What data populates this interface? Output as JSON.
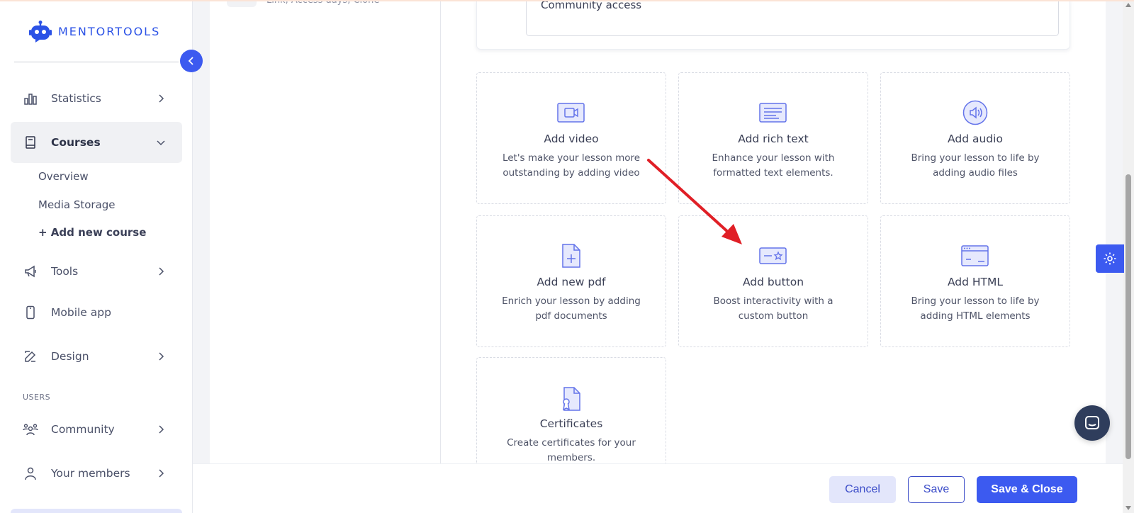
{
  "brand": {
    "name": "MENTORTOOLS",
    "accent": "#3c5af0"
  },
  "sidebar": {
    "items": [
      {
        "label": "Statistics",
        "icon": "bar-chart-icon"
      },
      {
        "label": "Courses",
        "icon": "book-icon",
        "active": true
      },
      {
        "label": "Tools",
        "icon": "megaphone-icon"
      },
      {
        "label": "Mobile app",
        "icon": "phone-icon"
      },
      {
        "label": "Design",
        "icon": "pencil-icon"
      },
      {
        "label": "Community",
        "icon": "people-icon"
      },
      {
        "label": "Your members",
        "icon": "user-icon"
      }
    ],
    "sub_items": [
      "Overview",
      "Media Storage",
      "+ Add new course"
    ],
    "section_users": "USERS"
  },
  "lesson_list": {
    "ghost_text": "Link, Access days, Clone"
  },
  "access": {
    "value": "Community access"
  },
  "tiles": [
    {
      "title": "Add video",
      "desc": "Let's make your lesson more outstanding by adding video",
      "icon": "video-icon"
    },
    {
      "title": "Add rich text",
      "desc": "Enhance your lesson with formatted text elements.",
      "icon": "rich-text-icon"
    },
    {
      "title": "Add audio",
      "desc": "Bring your lesson to life by adding audio files",
      "icon": "audio-icon"
    },
    {
      "title": "Add new pdf",
      "desc": "Enrich your lesson by adding pdf documents",
      "icon": "pdf-icon"
    },
    {
      "title": "Add button",
      "desc": "Boost interactivity with a custom button",
      "icon": "button-icon"
    },
    {
      "title": "Add HTML",
      "desc": "Bring your lesson to life by adding HTML elements",
      "icon": "html-icon"
    },
    {
      "title": "Certificates",
      "desc": "Create certificates for your members.",
      "icon": "certificate-icon"
    }
  ],
  "footer": {
    "cancel": "Cancel",
    "save": "Save",
    "save_close": "Save & Close"
  }
}
